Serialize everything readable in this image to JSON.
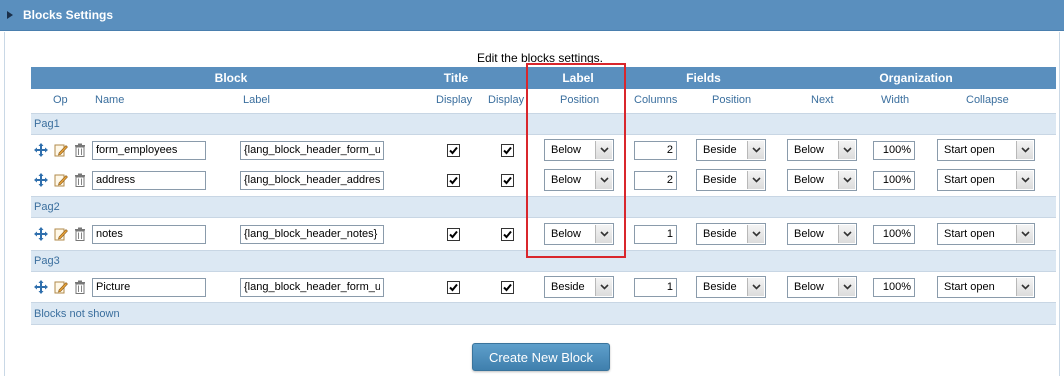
{
  "panel": {
    "title": "Blocks Settings"
  },
  "subtitle": "Edit the blocks settings.",
  "group_headers": {
    "block": "Block",
    "title": "Title",
    "label": "Label",
    "fields": "Fields",
    "organization": "Organization"
  },
  "columns": {
    "op": "Op",
    "name": "Name",
    "label": "Label",
    "title_display_1": "Display",
    "title_display_2": "Display",
    "label_position": "Position",
    "field_columns": "Columns",
    "field_position": "Position",
    "next": "Next",
    "width": "Width",
    "collapse": "Collapse"
  },
  "sections": [
    {
      "label": "Pag1",
      "rows": [
        {
          "name": "form_employees",
          "label": "{lang_block_header_form_up",
          "display1": true,
          "display2": true,
          "label_position": "Below",
          "columns": "2",
          "field_position": "Beside",
          "next": "Below",
          "width": "100%",
          "collapse": "Start open"
        },
        {
          "name": "address",
          "label": "{lang_block_header_address",
          "display1": true,
          "display2": true,
          "label_position": "Below",
          "columns": "2",
          "field_position": "Beside",
          "next": "Below",
          "width": "100%",
          "collapse": "Start open"
        }
      ]
    },
    {
      "label": "Pag2",
      "rows": [
        {
          "name": "notes",
          "label": "{lang_block_header_notes}",
          "display1": true,
          "display2": true,
          "label_position": "Below",
          "columns": "1",
          "field_position": "Beside",
          "next": "Below",
          "width": "100%",
          "collapse": "Start open"
        }
      ]
    },
    {
      "label": "Pag3",
      "rows": [
        {
          "name": "Picture",
          "label": "{lang_block_header_form_up",
          "display1": true,
          "display2": true,
          "label_position": "Beside",
          "columns": "1",
          "field_position": "Beside",
          "next": "Below",
          "width": "100%",
          "collapse": "Start open"
        }
      ]
    }
  ],
  "blocks_not_shown": "Blocks not shown",
  "create_button": "Create New Block",
  "colors": {
    "header_bg": "#5a8fbe",
    "section_bg": "#dce8f3",
    "accent_text": "#3b6f9e",
    "highlight": "#d9262c"
  },
  "icons": {
    "move": "move-arrows-icon",
    "edit": "edit-pencil-icon",
    "delete": "trash-icon"
  }
}
